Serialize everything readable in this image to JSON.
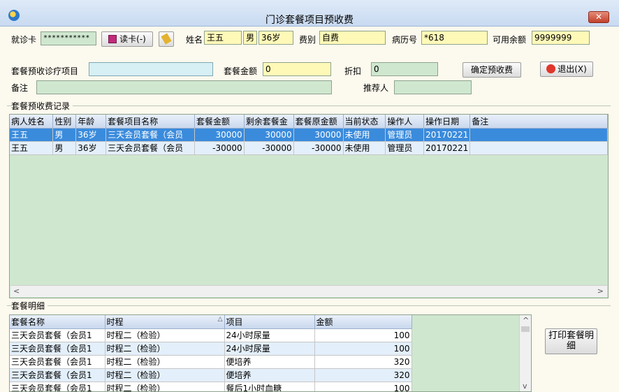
{
  "window": {
    "title": "门诊套餐项目预收费",
    "close_label": "✕"
  },
  "patient": {
    "card_label": "就诊卡",
    "card_value": "***********",
    "read_card_label": "读卡(-)",
    "name_label": "姓名",
    "name_value": "王五",
    "sex_value": "男",
    "age_value": "36岁",
    "fee_type_label": "费别",
    "fee_type_value": "自费",
    "record_no_label": "病历号",
    "record_no_value": "*618",
    "balance_label": "可用余额",
    "balance_value": "9999999"
  },
  "package_form": {
    "item_label": "套餐预收诊疗项目",
    "item_value": "",
    "amount_label": "套餐金额",
    "amount_value": "0",
    "discount_label": "折扣",
    "discount_value": "0",
    "confirm_label": "确定预收费",
    "exit_label": "退出(X)",
    "remark_label": "备注",
    "remark_value": "",
    "referrer_label": "推荐人",
    "referrer_value": ""
  },
  "records": {
    "section_title": "套餐预收费记录",
    "columns": [
      "病人姓名",
      "性别",
      "年龄",
      "套餐项目名称",
      "套餐金额",
      "剩余套餐金",
      "套餐原金额",
      "当前状态",
      "操作人",
      "操作日期",
      "备注"
    ],
    "rows": [
      [
        "王五",
        "男",
        "36岁",
        "三天会员套餐（会员",
        "30000",
        "30000",
        "30000",
        "未使用",
        "管理员",
        "20170221",
        ""
      ],
      [
        "王五",
        "男",
        "36岁",
        "三天会员套餐（会员",
        "-30000",
        "-30000",
        "-30000",
        "未使用",
        "管理员",
        "20170221",
        ""
      ]
    ],
    "selected_row": 0
  },
  "details": {
    "section_title": "套餐明细",
    "columns": [
      "套餐名称",
      "时程",
      "项目",
      "金额"
    ],
    "sort_indicator": "△",
    "rows": [
      [
        "三天会员套餐（会员1",
        "时程二（检验）",
        "24小时尿量",
        "100"
      ],
      [
        "三天会员套餐（会员1",
        "时程二（检验）",
        "24小时尿量",
        "100"
      ],
      [
        "三天会员套餐（会员1",
        "时程二（检验）",
        "便培养",
        "320"
      ],
      [
        "三天会员套餐（会员1",
        "时程二（检验）",
        "便培养",
        "320"
      ],
      [
        "三天会员套餐（会员1",
        "时程二（检验）",
        "餐后1小时血糖",
        "100"
      ]
    ],
    "print_label": "打印套餐明细"
  },
  "colors": {
    "selection": "#3a8bdc",
    "grid_background": "#cfe7cf",
    "yellow_field": "#fff9b8",
    "window_background": "#fcf9ee"
  }
}
